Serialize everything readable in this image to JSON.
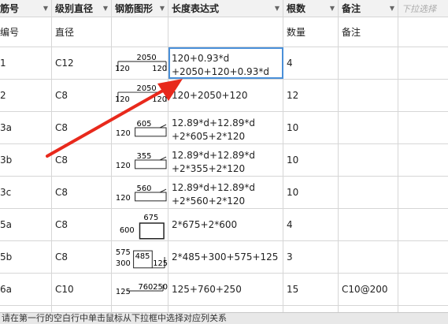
{
  "header": {
    "col_bar_no": "筋号",
    "col_grade": "级别直径",
    "col_shape": "钢筋图形",
    "col_length": "长度表达式",
    "col_count": "根数",
    "col_note": "备注",
    "dropdown_hint": "下拉选择"
  },
  "subheader": {
    "bar_no": "编号",
    "grade": "直径",
    "count": "数量",
    "note": "备注"
  },
  "rows": [
    {
      "bar_no": "1",
      "grade": "C12",
      "length_l1": "120+0.93*d",
      "length_l2": "+2050+120+0.93*d",
      "count": "4",
      "note": "",
      "shape_labels": [
        "2050",
        "120",
        "120"
      ]
    },
    {
      "bar_no": "2",
      "grade": "C8",
      "length_l1": "120+2050+120",
      "length_l2": "",
      "count": "12",
      "note": "",
      "shape_labels": [
        "2050",
        "120",
        "120"
      ]
    },
    {
      "bar_no": "3a",
      "grade": "C8",
      "length_l1": "12.89*d+12.89*d",
      "length_l2": "+2*605+2*120",
      "count": "10",
      "note": "",
      "shape_labels": [
        "605",
        "120"
      ]
    },
    {
      "bar_no": "3b",
      "grade": "C8",
      "length_l1": "12.89*d+12.89*d",
      "length_l2": "+2*355+2*120",
      "count": "10",
      "note": "",
      "shape_labels": [
        "355",
        "120"
      ]
    },
    {
      "bar_no": "3c",
      "grade": "C8",
      "length_l1": "12.89*d+12.89*d",
      "length_l2": "+2*560+2*120",
      "count": "10",
      "note": "",
      "shape_labels": [
        "560",
        "120"
      ]
    },
    {
      "bar_no": "5a",
      "grade": "C8",
      "length_l1": "2*675+2*600",
      "length_l2": "",
      "count": "4",
      "note": "",
      "shape_labels": [
        "675",
        "600"
      ]
    },
    {
      "bar_no": "5b",
      "grade": "C8",
      "length_l1": "2*485+300+575+125",
      "length_l2": "",
      "count": "3",
      "note": "",
      "shape_labels": [
        "575",
        "485",
        "300",
        "125"
      ]
    },
    {
      "bar_no": "6a",
      "grade": "C10",
      "length_l1": "125+760+250",
      "length_l2": "",
      "count": "15",
      "note": "C10@200",
      "shape_labels": [
        "125",
        "760",
        "250"
      ]
    }
  ],
  "status_text": "请在第一行的空白行中单击鼠标从下拉框中选择对应列关系",
  "colors": {
    "arrow": "#e8291c",
    "selection": "#4a90d9",
    "header_bg": "#f2f2f2",
    "grid": "#d6d6d6"
  }
}
